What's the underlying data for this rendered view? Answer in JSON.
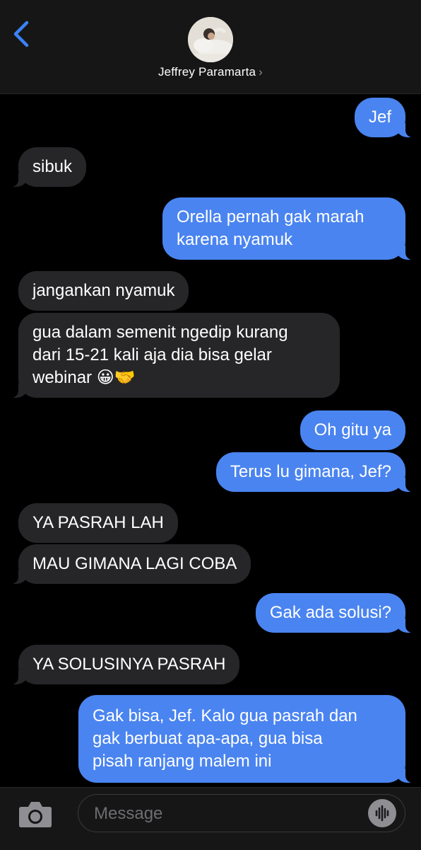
{
  "header": {
    "contact_name": "Jeffrey Paramarta",
    "chevron": "›"
  },
  "messages": [
    {
      "dir": "out",
      "text": "Jef"
    },
    {
      "dir": "in",
      "text": "sibuk"
    },
    {
      "dir": "out",
      "lines": [
        "Orella pernah gak marah",
        "karena nyamuk"
      ]
    },
    {
      "dir": "in",
      "text": "jangankan nyamuk"
    },
    {
      "dir": "in",
      "lines": [
        "gua dalam semenit ngedip kurang",
        "dari 15-21 kali aja dia bisa gelar",
        "webinar"
      ],
      "emoji": "😀🤝"
    },
    {
      "dir": "out",
      "text": "Oh gitu ya"
    },
    {
      "dir": "out",
      "text": "Terus lu gimana, Jef?"
    },
    {
      "dir": "in",
      "text": "YA PASRAH LAH"
    },
    {
      "dir": "in",
      "text": "MAU GIMANA LAGI COBA"
    },
    {
      "dir": "out",
      "text": "Gak ada solusi?"
    },
    {
      "dir": "in",
      "text": "YA SOLUSINYA PASRAH"
    },
    {
      "dir": "out",
      "lines": [
        "Gak bisa, Jef. Kalo gua pasrah dan",
        "gak berbuat apa-apa, gua bisa",
        "pisah ranjang malem ini"
      ]
    }
  ],
  "composer": {
    "placeholder": "Message",
    "value": ""
  },
  "icons": {
    "back": "chevron-left-icon",
    "camera": "camera-icon",
    "audio": "audio-waveform-icon"
  },
  "colors": {
    "outgoing_bubble": "#4a84f0",
    "incoming_bubble": "#262628",
    "accent": "#3b82f6"
  }
}
